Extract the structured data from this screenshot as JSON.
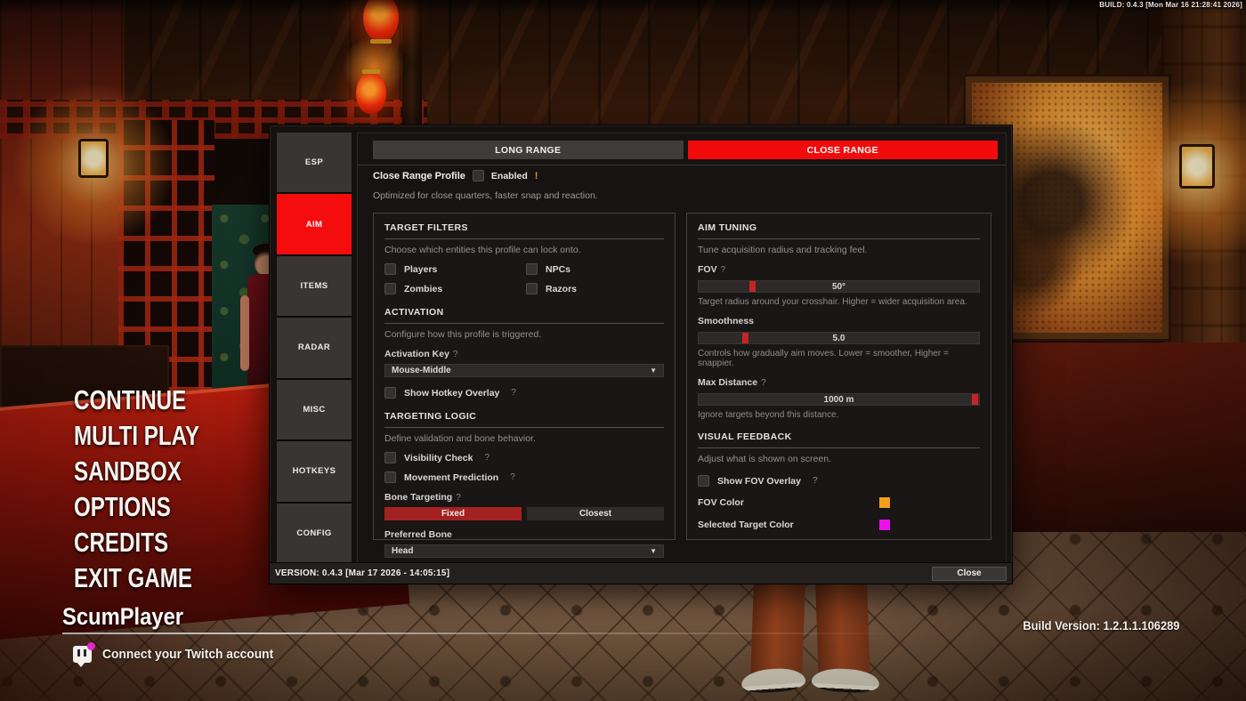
{
  "build_banner": "BUILD: 0.4.3 [Mon Mar 16 21:28:41 2026]",
  "help_marker": "?",
  "game_menu": {
    "items": [
      "CONTINUE",
      "MULTI PLAY",
      "SANDBOX",
      "OPTIONS",
      "CREDITS",
      "EXIT GAME"
    ],
    "player_name": "ScumPlayer",
    "twitch_label": "Connect your Twitch account",
    "build_version": "Build Version:  1.2.1.1.106289"
  },
  "panel": {
    "sidebar": {
      "items": [
        "ESP",
        "AIM",
        "ITEMS",
        "RADAR",
        "MISC",
        "HOTKEYS",
        "CONFIG"
      ],
      "active": "AIM"
    },
    "tabs": {
      "long_range": "LONG RANGE",
      "close_range": "CLOSE RANGE",
      "active": "CLOSE RANGE"
    },
    "profile": {
      "label": "Close Range Profile",
      "enabled_label": "Enabled",
      "warning": "!",
      "description": "Optimized for close quarters, faster snap and reaction."
    },
    "target_filters": {
      "title": "TARGET FILTERS",
      "description": "Choose which entities this profile can lock onto.",
      "checkboxes": [
        "Players",
        "NPCs",
        "Zombies",
        "Razors"
      ]
    },
    "activation": {
      "title": "ACTIVATION",
      "description": "Configure how this profile is triggered.",
      "activation_key_label": "Activation Key",
      "activation_key_value": "Mouse-Middle",
      "dropdown_arrow": "▼",
      "show_hotkey_overlay": "Show Hotkey Overlay"
    },
    "targeting_logic": {
      "title": "TARGETING LOGIC",
      "description": "Define validation and bone behavior.",
      "visibility_check": "Visibility Check",
      "movement_prediction": "Movement Prediction",
      "bone_targeting_label": "Bone Targeting",
      "bone_mode_fixed": "Fixed",
      "bone_mode_closest": "Closest",
      "bone_mode_active": "Fixed",
      "preferred_bone_label": "Preferred Bone",
      "preferred_bone_value": "Head"
    },
    "aim_tuning": {
      "title": "AIM TUNING",
      "description": "Tune acquisition radius and tracking feel.",
      "fov_label": "FOV",
      "fov_value": "50°",
      "fov_hint": "Target radius around your crosshair. Higher = wider acquisition area.",
      "smoothness_label": "Smoothness",
      "smoothness_value": "5.0",
      "smoothness_hint": "Controls how gradually aim moves. Lower = smoother, Higher = snappier.",
      "max_distance_label": "Max Distance",
      "max_distance_value": "1000 m",
      "max_distance_hint": "Ignore targets beyond this distance."
    },
    "visual_feedback": {
      "title": "VISUAL FEEDBACK",
      "description": "Adjust what is shown on screen.",
      "show_fov_overlay": "Show FOV Overlay",
      "fov_color_label": "FOV Color",
      "fov_color": "#f2a019",
      "selected_target_color_label": "Selected Target Color",
      "selected_target_color": "#ee10ee"
    },
    "footer": {
      "version": "VERSION: 0.4.3 [Mar 17 2026 - 14:05:15]",
      "close_label": "Close"
    }
  }
}
